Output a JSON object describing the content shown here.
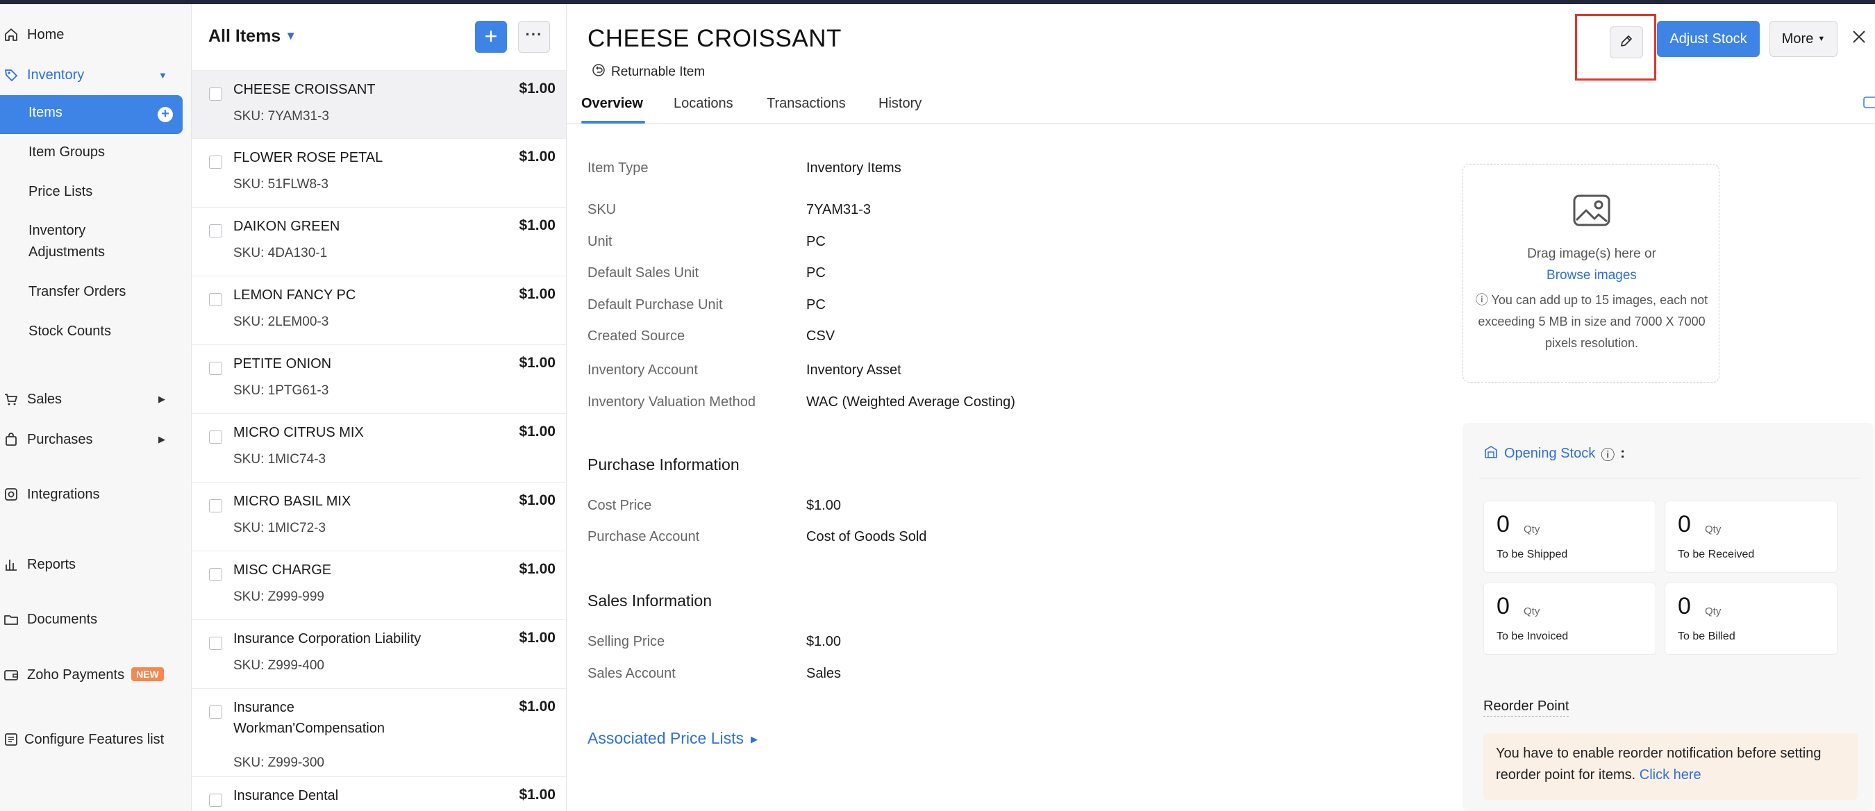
{
  "sidebar": {
    "home": "Home",
    "inventory": "Inventory",
    "inventory_items": [
      "Items",
      "Item Groups",
      "Price Lists",
      "Inventory Adjustments",
      "Transfer Orders",
      "Stock Counts"
    ],
    "sales": "Sales",
    "purchases": "Purchases",
    "integrations": "Integrations",
    "reports": "Reports",
    "documents": "Documents",
    "zoho_payments": "Zoho Payments",
    "new_badge": "NEW",
    "configure": "Configure Features list"
  },
  "list": {
    "title": "All Items",
    "new_button": "+",
    "more_button": "···",
    "items": [
      {
        "name": "CHEESE CROISSANT",
        "sku": "SKU: 7YAM31-3",
        "price": "$1.00"
      },
      {
        "name": "FLOWER ROSE PETAL",
        "sku": "SKU: 51FLW8-3",
        "price": "$1.00"
      },
      {
        "name": "DAIKON GREEN",
        "sku": "SKU: 4DA130-1",
        "price": "$1.00"
      },
      {
        "name": "LEMON FANCY PC",
        "sku": "SKU: 2LEM00-3",
        "price": "$1.00"
      },
      {
        "name": "PETITE ONION",
        "sku": "SKU: 1PTG61-3",
        "price": "$1.00"
      },
      {
        "name": "MICRO CITRUS MIX",
        "sku": "SKU: 1MIC74-3",
        "price": "$1.00"
      },
      {
        "name": "MICRO BASIL MIX",
        "sku": "SKU: 1MIC72-3",
        "price": "$1.00"
      },
      {
        "name": "MISC CHARGE",
        "sku": "SKU: Z999-999",
        "price": "$1.00"
      },
      {
        "name": "Insurance Corporation Liability",
        "sku": "SKU: Z999-400",
        "price": "$1.00"
      },
      {
        "name": "Insurance Workman'Compensation",
        "sku": "SKU: Z999-300",
        "price": "$1.00"
      },
      {
        "name": "Insurance Dental",
        "sku": "",
        "price": "$1.00"
      }
    ]
  },
  "detail": {
    "title": "CHEESE CROISSANT",
    "returnable": "Returnable Item",
    "adjust_stock": "Adjust Stock",
    "more": "More",
    "tabs": [
      "Overview",
      "Locations",
      "Transactions",
      "History"
    ],
    "fields": [
      {
        "label": "Item Type",
        "value": "Inventory Items"
      },
      {
        "label": "SKU",
        "value": "7YAM31-3"
      },
      {
        "label": "Unit",
        "value": "PC"
      },
      {
        "label": "Default Sales Unit",
        "value": "PC"
      },
      {
        "label": "Default Purchase Unit",
        "value": "PC"
      },
      {
        "label": "Created Source",
        "value": "CSV"
      },
      {
        "label": "Inventory Account",
        "value": "Inventory Asset"
      },
      {
        "label": "Inventory Valuation Method",
        "value": "WAC (Weighted Average Costing)"
      }
    ],
    "purchase": {
      "heading": "Purchase Information",
      "fields": [
        {
          "label": "Cost Price",
          "value": "$1.00"
        },
        {
          "label": "Purchase Account",
          "value": "Cost of Goods Sold"
        }
      ]
    },
    "sales": {
      "heading": "Sales Information",
      "fields": [
        {
          "label": "Selling Price",
          "value": "$1.00"
        },
        {
          "label": "Sales Account",
          "value": "Sales"
        }
      ]
    },
    "associated": "Associated Price Lists",
    "image": {
      "drag": "Drag image(s) here or",
      "browse": "Browse images",
      "note": "You can add up to 15 images, each not exceeding 5 MB in size and 7000 X 7000 pixels resolution."
    },
    "opening_stock": {
      "title": "Opening Stock",
      "colon": ":",
      "cards": [
        {
          "value": "0",
          "unit": "Qty",
          "label": "To be Shipped"
        },
        {
          "value": "0",
          "unit": "Qty",
          "label": "To be Received"
        },
        {
          "value": "0",
          "unit": "Qty",
          "label": "To be Invoiced"
        },
        {
          "value": "0",
          "unit": "Qty",
          "label": "To be Billed"
        }
      ]
    },
    "reorder": {
      "title": "Reorder Point",
      "note": "You have to enable reorder notification before setting reorder point for items.",
      "link": "Click here"
    }
  }
}
